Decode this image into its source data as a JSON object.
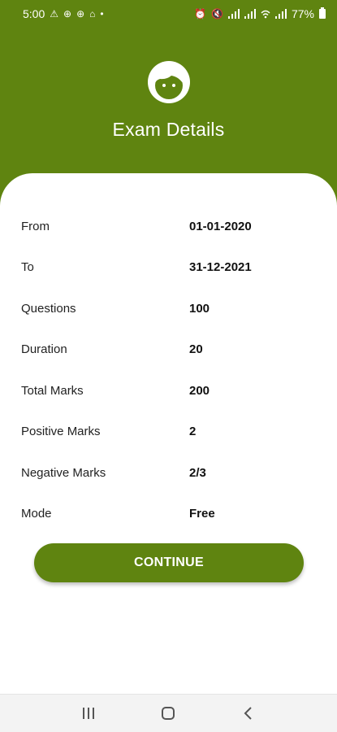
{
  "status_bar": {
    "time": "5:00",
    "battery": "77%",
    "icons_left": [
      "warning-icon",
      "soccer-ball-icon",
      "soccer-ball-icon",
      "graduation-cap-icon",
      "dot-icon"
    ],
    "icons_right": [
      "alarm-icon",
      "mute-icon",
      "signal-icon",
      "signal-icon",
      "wifi-icon",
      "signal-icon",
      "battery-icon"
    ]
  },
  "header": {
    "title": "Exam Details",
    "icon": "face-icon"
  },
  "details": {
    "rows": [
      {
        "label": "From",
        "value": "01-01-2020"
      },
      {
        "label": "To",
        "value": "31-12-2021"
      },
      {
        "label": "Questions",
        "value": "100"
      },
      {
        "label": "Duration",
        "value": "20"
      },
      {
        "label": "Total Marks",
        "value": "200"
      },
      {
        "label": "Positive Marks",
        "value": "2"
      },
      {
        "label": "Negative Marks",
        "value": "2/3"
      },
      {
        "label": "Mode",
        "value": "Free"
      }
    ]
  },
  "continue_label": "CONTINUE",
  "colors": {
    "primary": "#5f8410",
    "card": "#ffffff",
    "nav": "#f3f3f3"
  },
  "nav_bar": [
    "recent-apps-icon",
    "home-icon",
    "back-icon"
  ]
}
